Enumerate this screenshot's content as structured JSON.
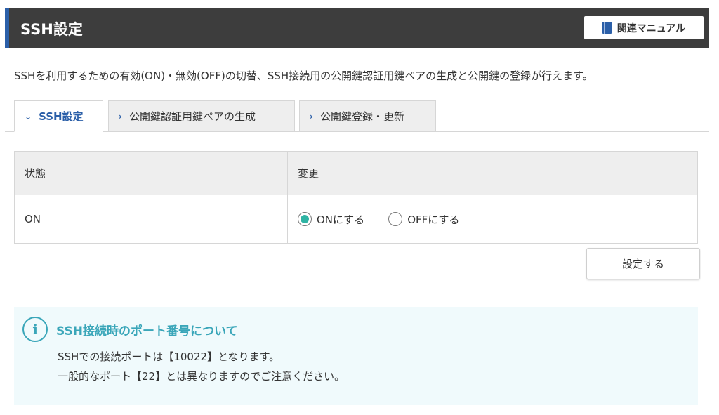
{
  "header": {
    "title": "SSH設定",
    "manual_button": "関連マニュアル"
  },
  "description": "SSHを利用するための有効(ON)・無効(OFF)の切替、SSH接続用の公開鍵認証用鍵ペアの生成と公開鍵の登録が行えます。",
  "tabs": [
    {
      "label": "SSH設定",
      "active": true
    },
    {
      "label": "公開鍵認証用鍵ペアの生成",
      "active": false
    },
    {
      "label": "公開鍵登録・更新",
      "active": false
    }
  ],
  "table": {
    "headers": [
      "状態",
      "変更"
    ],
    "status_value": "ON",
    "options": [
      {
        "label": "ONにする",
        "checked": true
      },
      {
        "label": "OFFにする",
        "checked": false
      }
    ]
  },
  "submit_button": "設定する",
  "info": {
    "title": "SSH接続時のポート番号について",
    "lines": [
      "SSHでの接続ポートは【10022】となります。",
      "一般的なポート【22】とは異なりますのでご注意ください。"
    ]
  },
  "colors": {
    "header_bg": "#3d3d3d",
    "accent_blue": "#2b5fa8",
    "radio_checked": "#2fb4a4",
    "info_accent": "#3aa6b9",
    "info_bg": "#f0fafc"
  },
  "icons": [
    "book-icon",
    "chevron-down-icon",
    "chevron-right-icon",
    "info-icon"
  ]
}
